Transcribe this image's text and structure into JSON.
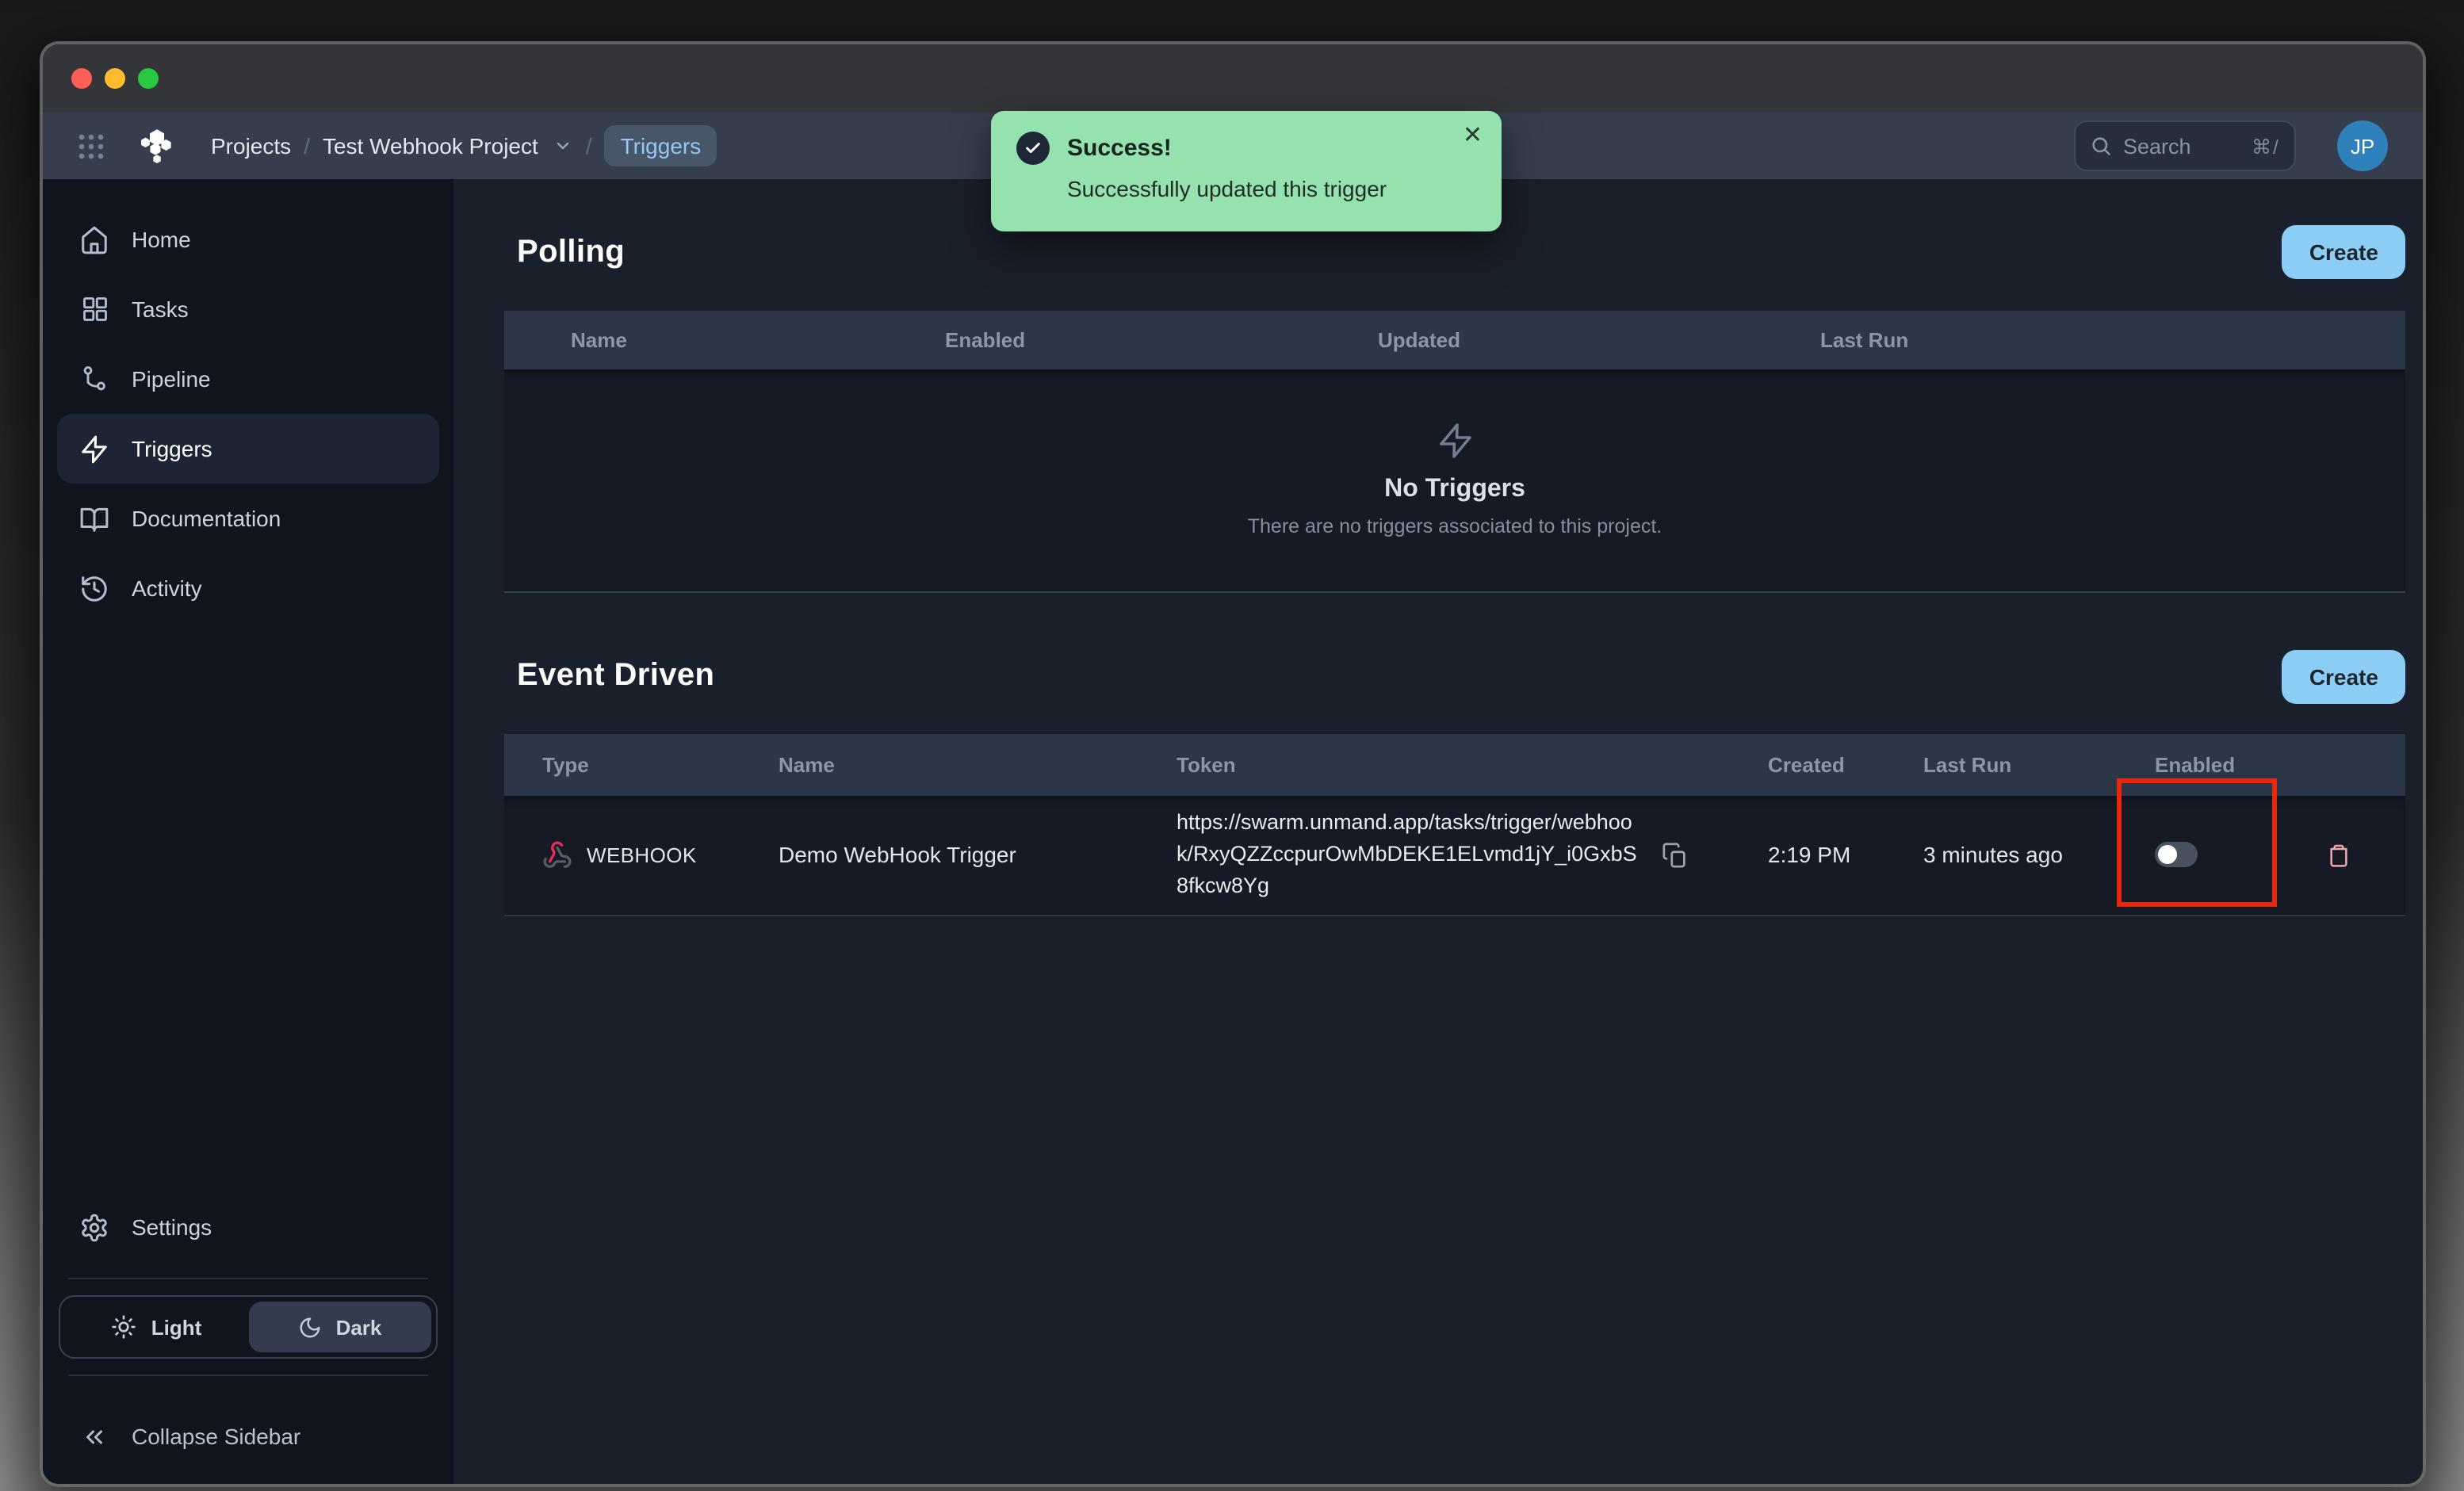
{
  "header": {
    "breadcrumb": {
      "projects": "Projects",
      "separator": "/",
      "project": "Test Webhook Project",
      "current": "Triggers"
    },
    "search": {
      "placeholder": "Search",
      "shortcut": "⌘/"
    },
    "avatar_initials": "JP"
  },
  "toast": {
    "title": "Success!",
    "message": "Successfully updated this trigger",
    "close": "✕"
  },
  "sidebar": {
    "items": [
      {
        "label": "Home"
      },
      {
        "label": "Tasks"
      },
      {
        "label": "Pipeline"
      },
      {
        "label": "Triggers"
      },
      {
        "label": "Documentation"
      },
      {
        "label": "Activity"
      }
    ],
    "settings_label": "Settings",
    "theme": {
      "light_label": "Light",
      "dark_label": "Dark",
      "selected": "Dark"
    },
    "collapse_label": "Collapse Sidebar"
  },
  "polling": {
    "title": "Polling",
    "create_label": "Create",
    "columns": [
      "Name",
      "Enabled",
      "Updated",
      "Last Run"
    ],
    "empty": {
      "title": "No Triggers",
      "message": "There are no triggers associated to this project."
    }
  },
  "event": {
    "title": "Event Driven",
    "create_label": "Create",
    "columns": [
      "Type",
      "Name",
      "Token",
      "Created",
      "Last Run",
      "Enabled"
    ],
    "row": {
      "type": "WEBHOOK",
      "name": "Demo WebHook Trigger",
      "token": "https://swarm.unmand.app/tasks/trigger/webhook/RxyQZZccpurOwMbDEKE1ELvmd1jY_i0GxbS8fkcw8Yg",
      "created": "2:19 PM",
      "last_run": "3 minutes ago",
      "enabled": false
    }
  },
  "colors": {
    "accent_button": "#8bcdf5",
    "toast_green": "#95e2ae",
    "annotation_red": "#e8270d",
    "webhook_pink": "#e62c5c",
    "avatar_blue": "#2e81bb"
  }
}
